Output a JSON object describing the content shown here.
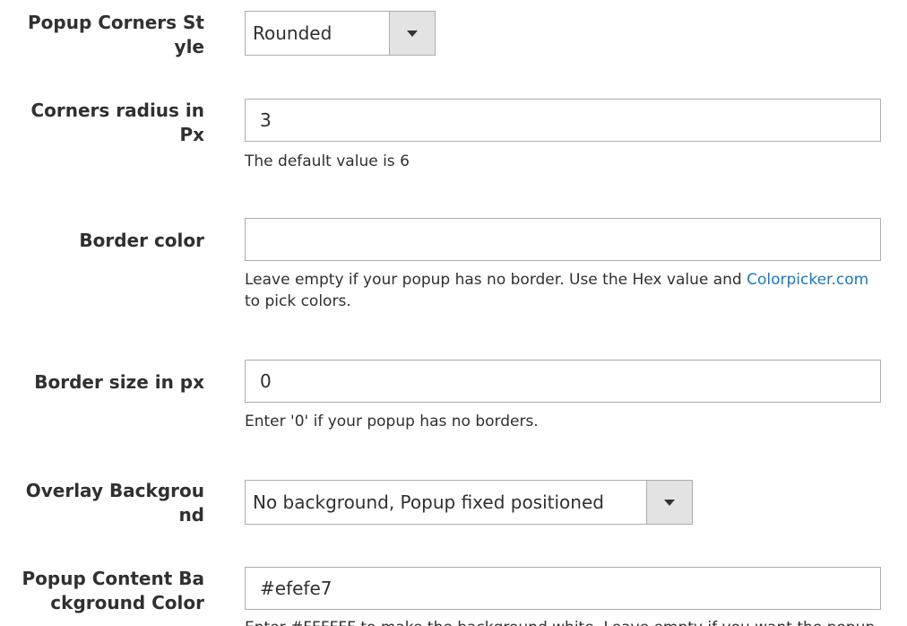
{
  "fields": {
    "corners_style": {
      "label": "Popup Corners Style",
      "value": "Rounded"
    },
    "corners_radius": {
      "label": "Corners radius in Px",
      "value": "3",
      "note": "The default value is 6"
    },
    "border_color": {
      "label": "Border color",
      "value": "",
      "note_before": "Leave empty if your popup has no border. Use the Hex value and ",
      "note_link": "Colorpicker.com",
      "note_after": " to pick colors."
    },
    "border_size": {
      "label": "Border size in px",
      "value": "0",
      "note": "Enter '0' if your popup has no borders."
    },
    "overlay_background": {
      "label": "Overlay Background",
      "value": "No background, Popup fixed positioned"
    },
    "content_bg_color": {
      "label": "Popup Content Background Color",
      "value": "#efefe7",
      "note": "Enter #FFFFFF to make the background white. Leave empty if you want the popup"
    }
  },
  "colors": {
    "link": "#1979c3",
    "text": "#303030",
    "border": "#adadad",
    "select_button": "#e3e3e3"
  },
  "icons": {
    "dropdown": "chevron-down-icon"
  }
}
